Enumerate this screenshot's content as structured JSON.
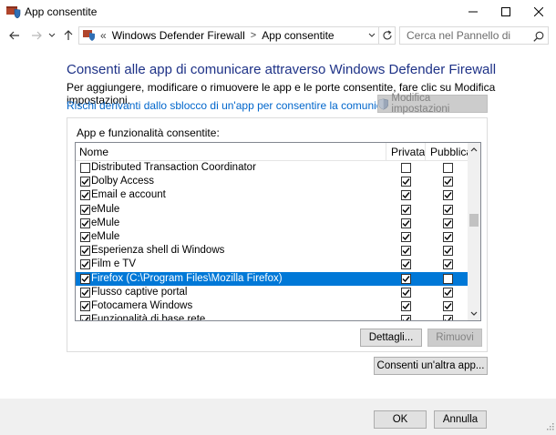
{
  "window": {
    "title": "App consentite"
  },
  "address": {
    "overflow_chevron": "«",
    "crumbs": [
      "Windows Defender Firewall",
      "App consentite"
    ],
    "separator": ">"
  },
  "search": {
    "placeholder": "Cerca nel Pannello di controllo"
  },
  "content": {
    "heading": "Consenti alle app di comunicare attraverso Windows Defender Firewall",
    "intro": "Per aggiungere, modificare o rimuovere le app e le porte consentite, fare clic su Modifica impostazioni.",
    "risk_link": "Rischi derivanti dallo sblocco di un'app per consentire la comunicazione",
    "modify_button": "Modifica impostazioni"
  },
  "list": {
    "group_label": "App e funzionalità consentite:",
    "columns": {
      "name": "Nome",
      "private": "Privata",
      "public": "Pubblica"
    },
    "rows": [
      {
        "name": "Distributed Transaction Coordinator",
        "enabled": false,
        "private": false,
        "public": false,
        "selected": false
      },
      {
        "name": "Dolby Access",
        "enabled": true,
        "private": true,
        "public": true,
        "selected": false
      },
      {
        "name": "Email e account",
        "enabled": true,
        "private": true,
        "public": true,
        "selected": false
      },
      {
        "name": "eMule",
        "enabled": true,
        "private": true,
        "public": true,
        "selected": false
      },
      {
        "name": "eMule",
        "enabled": true,
        "private": true,
        "public": true,
        "selected": false
      },
      {
        "name": "eMule",
        "enabled": true,
        "private": true,
        "public": true,
        "selected": false
      },
      {
        "name": "Esperienza shell di Windows",
        "enabled": true,
        "private": true,
        "public": true,
        "selected": false
      },
      {
        "name": "Film e TV",
        "enabled": true,
        "private": true,
        "public": true,
        "selected": false
      },
      {
        "name": "Firefox (C:\\Program Files\\Mozilla Firefox)",
        "enabled": true,
        "private": true,
        "public": false,
        "selected": true
      },
      {
        "name": "Flusso captive portal",
        "enabled": true,
        "private": true,
        "public": true,
        "selected": false
      },
      {
        "name": "Fotocamera Windows",
        "enabled": true,
        "private": true,
        "public": true,
        "selected": false
      },
      {
        "name": "Funzionalità di base rete",
        "enabled": true,
        "private": true,
        "public": true,
        "selected": false
      }
    ],
    "details_button": "Dettagli...",
    "remove_button": "Rimuovi"
  },
  "allow_another_button": "Consenti un'altra app...",
  "footer": {
    "ok_button": "OK",
    "cancel_button": "Annulla"
  },
  "colors": {
    "heading": "#1e3287",
    "link": "#0066cc",
    "selection": "#0078d7"
  }
}
